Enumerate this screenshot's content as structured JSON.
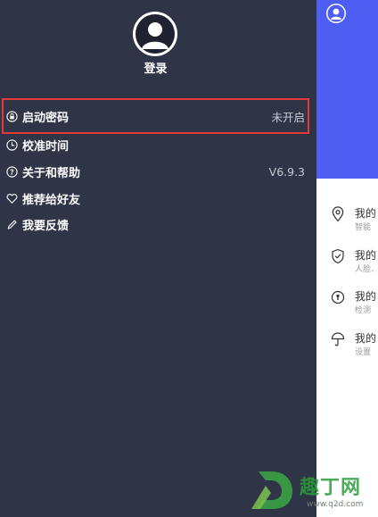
{
  "drawer": {
    "login_label": "登录",
    "items": [
      {
        "label": "启动密码",
        "value": "未开启",
        "icon": "lock-icon"
      },
      {
        "label": "校准时间",
        "value": "",
        "icon": "clock-icon"
      },
      {
        "label": "关于和帮助",
        "value": "V6.9.3",
        "icon": "help-icon"
      },
      {
        "label": "推荐给好友",
        "value": "",
        "icon": "heart-icon"
      },
      {
        "label": "我要反馈",
        "value": "",
        "icon": "pencil-icon"
      }
    ]
  },
  "panel": {
    "features": [
      {
        "title": "我的",
        "subtitle": "智能",
        "icon": "location-pin-icon"
      },
      {
        "title": "我的",
        "subtitle": "人脸、",
        "icon": "shield-icon"
      },
      {
        "title": "我的",
        "subtitle": "检测",
        "icon": "keyhole-icon"
      },
      {
        "title": "我的",
        "subtitle": "设置",
        "icon": "umbrella-icon"
      }
    ]
  },
  "watermark": {
    "text": "趣丁网",
    "url": "www.q2d.com"
  },
  "colors": {
    "drawer_bg": "#2f3446",
    "header_blue": "#4f5ef2",
    "highlight_red": "#e53935"
  }
}
